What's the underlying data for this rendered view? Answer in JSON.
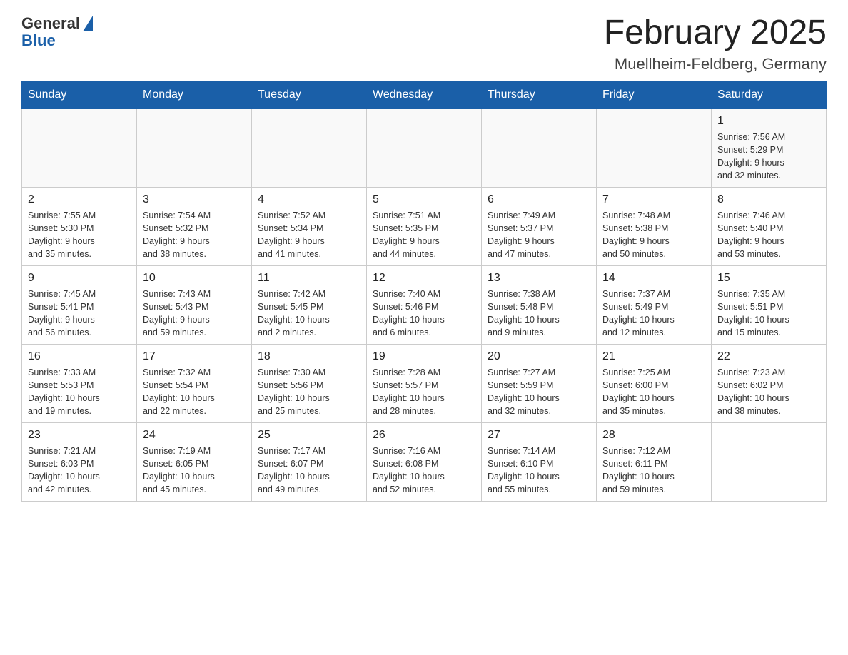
{
  "header": {
    "logo_general": "General",
    "logo_blue": "Blue",
    "month_title": "February 2025",
    "location": "Muellheim-Feldberg, Germany"
  },
  "days_of_week": [
    "Sunday",
    "Monday",
    "Tuesday",
    "Wednesday",
    "Thursday",
    "Friday",
    "Saturday"
  ],
  "weeks": [
    [
      {
        "day": "",
        "info": ""
      },
      {
        "day": "",
        "info": ""
      },
      {
        "day": "",
        "info": ""
      },
      {
        "day": "",
        "info": ""
      },
      {
        "day": "",
        "info": ""
      },
      {
        "day": "",
        "info": ""
      },
      {
        "day": "1",
        "info": "Sunrise: 7:56 AM\nSunset: 5:29 PM\nDaylight: 9 hours\nand 32 minutes."
      }
    ],
    [
      {
        "day": "2",
        "info": "Sunrise: 7:55 AM\nSunset: 5:30 PM\nDaylight: 9 hours\nand 35 minutes."
      },
      {
        "day": "3",
        "info": "Sunrise: 7:54 AM\nSunset: 5:32 PM\nDaylight: 9 hours\nand 38 minutes."
      },
      {
        "day": "4",
        "info": "Sunrise: 7:52 AM\nSunset: 5:34 PM\nDaylight: 9 hours\nand 41 minutes."
      },
      {
        "day": "5",
        "info": "Sunrise: 7:51 AM\nSunset: 5:35 PM\nDaylight: 9 hours\nand 44 minutes."
      },
      {
        "day": "6",
        "info": "Sunrise: 7:49 AM\nSunset: 5:37 PM\nDaylight: 9 hours\nand 47 minutes."
      },
      {
        "day": "7",
        "info": "Sunrise: 7:48 AM\nSunset: 5:38 PM\nDaylight: 9 hours\nand 50 minutes."
      },
      {
        "day": "8",
        "info": "Sunrise: 7:46 AM\nSunset: 5:40 PM\nDaylight: 9 hours\nand 53 minutes."
      }
    ],
    [
      {
        "day": "9",
        "info": "Sunrise: 7:45 AM\nSunset: 5:41 PM\nDaylight: 9 hours\nand 56 minutes."
      },
      {
        "day": "10",
        "info": "Sunrise: 7:43 AM\nSunset: 5:43 PM\nDaylight: 9 hours\nand 59 minutes."
      },
      {
        "day": "11",
        "info": "Sunrise: 7:42 AM\nSunset: 5:45 PM\nDaylight: 10 hours\nand 2 minutes."
      },
      {
        "day": "12",
        "info": "Sunrise: 7:40 AM\nSunset: 5:46 PM\nDaylight: 10 hours\nand 6 minutes."
      },
      {
        "day": "13",
        "info": "Sunrise: 7:38 AM\nSunset: 5:48 PM\nDaylight: 10 hours\nand 9 minutes."
      },
      {
        "day": "14",
        "info": "Sunrise: 7:37 AM\nSunset: 5:49 PM\nDaylight: 10 hours\nand 12 minutes."
      },
      {
        "day": "15",
        "info": "Sunrise: 7:35 AM\nSunset: 5:51 PM\nDaylight: 10 hours\nand 15 minutes."
      }
    ],
    [
      {
        "day": "16",
        "info": "Sunrise: 7:33 AM\nSunset: 5:53 PM\nDaylight: 10 hours\nand 19 minutes."
      },
      {
        "day": "17",
        "info": "Sunrise: 7:32 AM\nSunset: 5:54 PM\nDaylight: 10 hours\nand 22 minutes."
      },
      {
        "day": "18",
        "info": "Sunrise: 7:30 AM\nSunset: 5:56 PM\nDaylight: 10 hours\nand 25 minutes."
      },
      {
        "day": "19",
        "info": "Sunrise: 7:28 AM\nSunset: 5:57 PM\nDaylight: 10 hours\nand 28 minutes."
      },
      {
        "day": "20",
        "info": "Sunrise: 7:27 AM\nSunset: 5:59 PM\nDaylight: 10 hours\nand 32 minutes."
      },
      {
        "day": "21",
        "info": "Sunrise: 7:25 AM\nSunset: 6:00 PM\nDaylight: 10 hours\nand 35 minutes."
      },
      {
        "day": "22",
        "info": "Sunrise: 7:23 AM\nSunset: 6:02 PM\nDaylight: 10 hours\nand 38 minutes."
      }
    ],
    [
      {
        "day": "23",
        "info": "Sunrise: 7:21 AM\nSunset: 6:03 PM\nDaylight: 10 hours\nand 42 minutes."
      },
      {
        "day": "24",
        "info": "Sunrise: 7:19 AM\nSunset: 6:05 PM\nDaylight: 10 hours\nand 45 minutes."
      },
      {
        "day": "25",
        "info": "Sunrise: 7:17 AM\nSunset: 6:07 PM\nDaylight: 10 hours\nand 49 minutes."
      },
      {
        "day": "26",
        "info": "Sunrise: 7:16 AM\nSunset: 6:08 PM\nDaylight: 10 hours\nand 52 minutes."
      },
      {
        "day": "27",
        "info": "Sunrise: 7:14 AM\nSunset: 6:10 PM\nDaylight: 10 hours\nand 55 minutes."
      },
      {
        "day": "28",
        "info": "Sunrise: 7:12 AM\nSunset: 6:11 PM\nDaylight: 10 hours\nand 59 minutes."
      },
      {
        "day": "",
        "info": ""
      }
    ]
  ]
}
